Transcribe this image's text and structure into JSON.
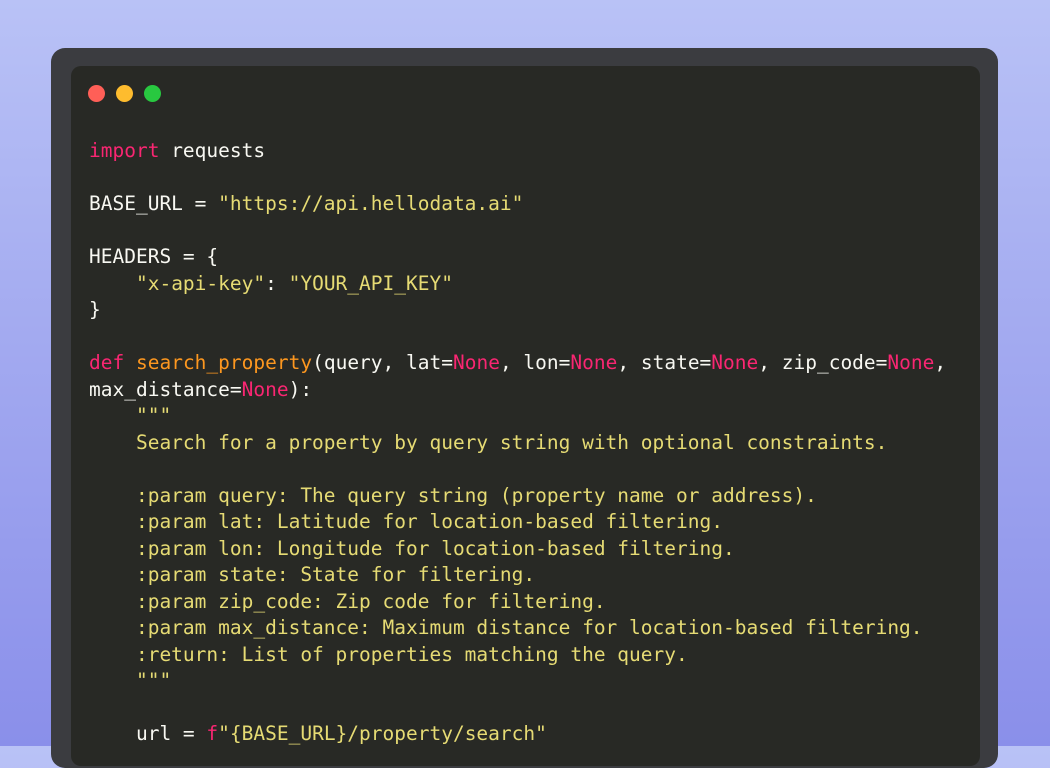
{
  "window": {
    "controls": [
      {
        "name": "close",
        "color": "#ff5f57"
      },
      {
        "name": "minimize",
        "color": "#febc2e"
      },
      {
        "name": "maximize",
        "color": "#28c840"
      }
    ]
  },
  "code": {
    "lines": [
      [
        {
          "t": "import",
          "c": "kw"
        },
        {
          "t": " requests"
        }
      ],
      [],
      [
        {
          "t": "BASE_URL = "
        },
        {
          "t": "\"https://api.hellodata.ai\"",
          "c": "str"
        }
      ],
      [],
      [
        {
          "t": "HEADERS = {"
        }
      ],
      [
        {
          "t": "    "
        },
        {
          "t": "\"x-api-key\"",
          "c": "str"
        },
        {
          "t": ": "
        },
        {
          "t": "\"YOUR_API_KEY\"",
          "c": "str"
        }
      ],
      [
        {
          "t": "}"
        }
      ],
      [],
      [
        {
          "t": "def",
          "c": "kw"
        },
        {
          "t": " "
        },
        {
          "t": "search_property",
          "c": "fn"
        },
        {
          "t": "(query, lat="
        },
        {
          "t": "None",
          "c": "kw"
        },
        {
          "t": ", lon="
        },
        {
          "t": "None",
          "c": "kw"
        },
        {
          "t": ", state="
        },
        {
          "t": "None",
          "c": "kw"
        },
        {
          "t": ", zip_code="
        },
        {
          "t": "None",
          "c": "kw"
        },
        {
          "t": ","
        }
      ],
      [
        {
          "t": "max_distance="
        },
        {
          "t": "None",
          "c": "kw"
        },
        {
          "t": "):"
        }
      ],
      [
        {
          "t": "    \"\"\"",
          "c": "doc"
        }
      ],
      [
        {
          "t": "    Search for a property by query string with optional constraints.",
          "c": "doc"
        }
      ],
      [],
      [
        {
          "t": "    :param query: The query string (property name or address).",
          "c": "doc"
        }
      ],
      [
        {
          "t": "    :param lat: Latitude for location-based filtering.",
          "c": "doc"
        }
      ],
      [
        {
          "t": "    :param lon: Longitude for location-based filtering.",
          "c": "doc"
        }
      ],
      [
        {
          "t": "    :param state: State for filtering.",
          "c": "doc"
        }
      ],
      [
        {
          "t": "    :param zip_code: Zip code for filtering.",
          "c": "doc"
        }
      ],
      [
        {
          "t": "    :param max_distance: Maximum distance for location-based filtering.",
          "c": "doc"
        }
      ],
      [
        {
          "t": "    :return: List of properties matching the query.",
          "c": "doc"
        }
      ],
      [
        {
          "t": "    \"\"\"",
          "c": "doc"
        }
      ],
      [],
      [
        {
          "t": "    url = "
        },
        {
          "t": "f",
          "c": "kw"
        },
        {
          "t": "\"{BASE_URL}/property/search\"",
          "c": "str"
        }
      ]
    ]
  }
}
